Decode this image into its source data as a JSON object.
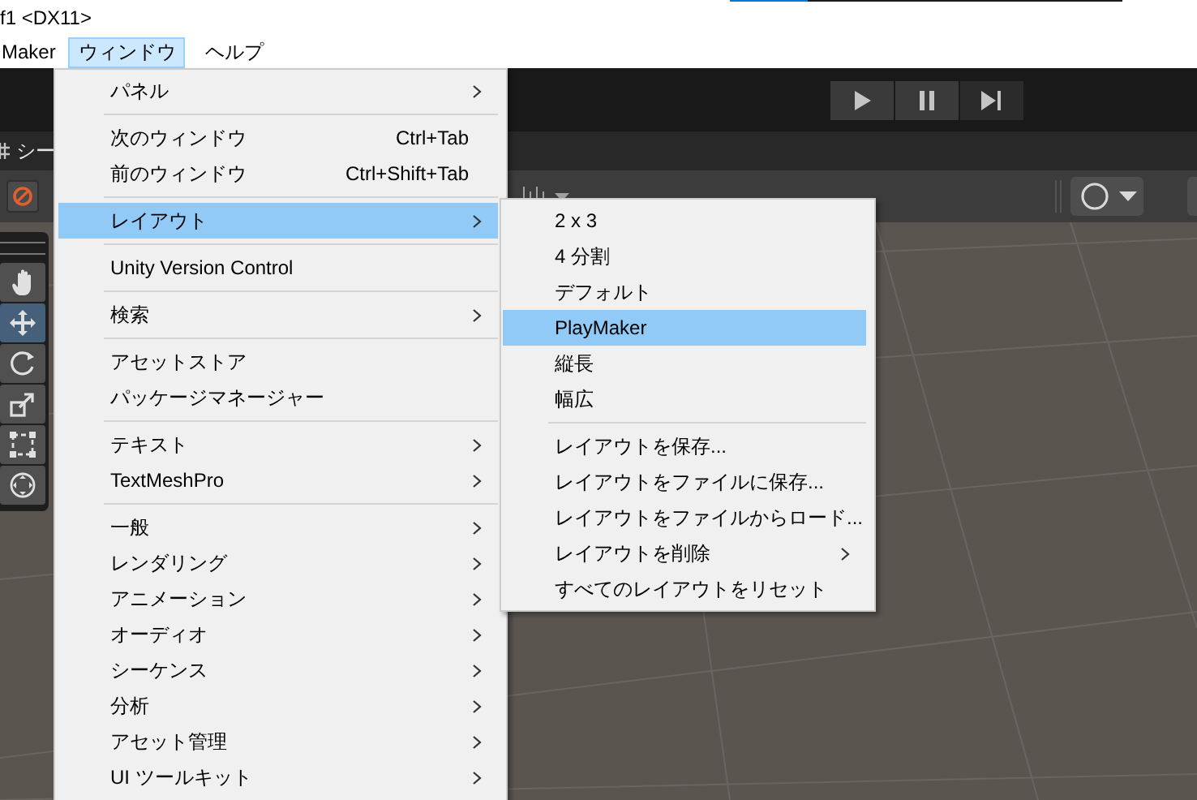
{
  "window": {
    "title": "f1 <DX11>",
    "loading_bar": {
      "level": 0.2
    }
  },
  "menu_bar": [
    {
      "label": "Maker",
      "selected": false
    },
    {
      "label": "ウィンドウ",
      "selected": true
    },
    {
      "label": "ヘルプ",
      "selected": false
    }
  ],
  "scene_tab": {
    "label": "シー"
  },
  "tools": [
    {
      "kind": "hand",
      "selected": false
    },
    {
      "kind": "move",
      "selected": true
    },
    {
      "kind": "rotate",
      "selected": false
    },
    {
      "kind": "scale",
      "selected": false
    },
    {
      "kind": "rect",
      "selected": false
    },
    {
      "kind": "transform",
      "selected": false
    }
  ],
  "window_menu": [
    [
      {
        "label": "パネル",
        "submenu": true,
        "selected": false
      }
    ],
    [
      {
        "label": "次のウィンドウ",
        "shortcut": "Ctrl+Tab",
        "submenu": false,
        "selected": false
      },
      {
        "label": "前のウィンドウ",
        "shortcut": "Ctrl+Shift+Tab",
        "submenu": false,
        "selected": false
      }
    ],
    [
      {
        "label": "レイアウト",
        "submenu": true,
        "selected": true
      }
    ],
    [
      {
        "label": "Unity Version Control",
        "submenu": false,
        "selected": false
      }
    ],
    [
      {
        "label": "検索",
        "submenu": true,
        "selected": false
      }
    ],
    [
      {
        "label": "アセットストア",
        "submenu": false,
        "selected": false
      },
      {
        "label": "パッケージマネージャー",
        "submenu": false,
        "selected": false
      }
    ],
    [
      {
        "label": "テキスト",
        "submenu": true,
        "selected": false
      },
      {
        "label": "TextMeshPro",
        "submenu": true,
        "selected": false
      }
    ],
    [
      {
        "label": "一般",
        "submenu": true,
        "selected": false
      },
      {
        "label": "レンダリング",
        "submenu": true,
        "selected": false
      },
      {
        "label": "アニメーション",
        "submenu": true,
        "selected": false
      },
      {
        "label": "オーディオ",
        "submenu": true,
        "selected": false
      },
      {
        "label": "シーケンス",
        "submenu": true,
        "selected": false
      },
      {
        "label": "分析",
        "submenu": true,
        "selected": false
      },
      {
        "label": "アセット管理",
        "submenu": true,
        "selected": false
      },
      {
        "label": "UI ツールキット",
        "submenu": true,
        "selected": false
      }
    ]
  ],
  "layout_submenu": [
    [
      {
        "label": "2 x 3",
        "submenu": false,
        "selected": false
      },
      {
        "label": "4 分割",
        "submenu": false,
        "selected": false
      },
      {
        "label": "デフォルト",
        "submenu": false,
        "selected": false
      },
      {
        "label": "PlayMaker",
        "submenu": false,
        "selected": true
      },
      {
        "label": "縦長",
        "submenu": false,
        "selected": false
      },
      {
        "label": "幅広",
        "submenu": false,
        "selected": false
      }
    ],
    [
      {
        "label": "レイアウトを保存...",
        "submenu": false,
        "selected": false
      },
      {
        "label": "レイアウトをファイルに保存...",
        "submenu": false,
        "selected": false
      },
      {
        "label": "レイアウトをファイルからロード...",
        "submenu": false,
        "selected": false
      },
      {
        "label": "レイアウトを削除",
        "submenu": true,
        "selected": false
      },
      {
        "label": "すべてのレイアウトをリセット",
        "submenu": false,
        "selected": false
      }
    ]
  ]
}
